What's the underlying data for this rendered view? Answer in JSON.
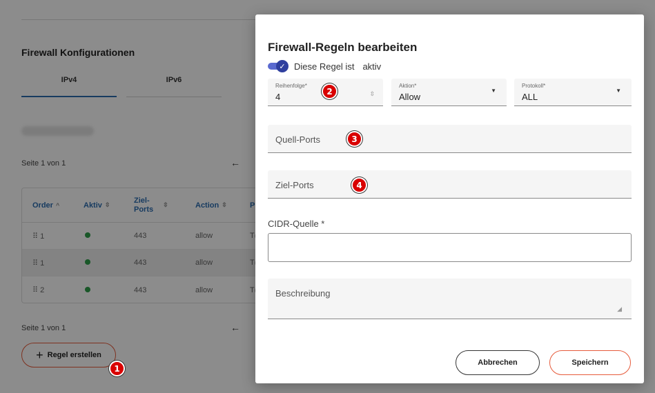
{
  "background": {
    "section_title": "Firewall Konfigurationen",
    "tabs": [
      {
        "label": "IPv4",
        "active": true
      },
      {
        "label": "IPv6",
        "active": false
      }
    ],
    "pagination_top": "Seite 1 von 1",
    "pagination_bottom": "Seite 1 von 1",
    "prev_arrow": "←",
    "table": {
      "headers": [
        {
          "label": "Order",
          "sort": "^"
        },
        {
          "label": "Aktiv",
          "sort": "⇳"
        },
        {
          "label_line1": "Ziel-",
          "label_line2": "Ports",
          "sort": "⇳"
        },
        {
          "label": "Action",
          "sort": "⇳"
        },
        {
          "label": "P"
        }
      ],
      "rows": [
        {
          "order": "⠿ 1",
          "active": true,
          "ports": "443",
          "action": "allow",
          "proto": "T(",
          "highlighted": false
        },
        {
          "order": "⠿ 1",
          "active": true,
          "ports": "443",
          "action": "allow",
          "proto": "T(",
          "highlighted": true
        },
        {
          "order": "⠿ 2",
          "active": true,
          "ports": "443",
          "action": "allow",
          "proto": "T(",
          "highlighted": false
        }
      ]
    },
    "create_button": {
      "icon": "+",
      "label": "Regel erstellen"
    }
  },
  "badges": [
    "1",
    "2",
    "3",
    "4"
  ],
  "modal": {
    "title": "Firewall-Regeln bearbeiten",
    "toggle": {
      "label": "Diese Regel ist",
      "status": "aktiv",
      "on": true,
      "check": "✓"
    },
    "order_field": {
      "label": "Reihenfolge*",
      "value": "4",
      "spinner": "⇳"
    },
    "action_field": {
      "label": "Aktion*",
      "value": "Allow",
      "caret": "▼"
    },
    "protocol_field": {
      "label": "Protokoll*",
      "value": "ALL",
      "caret": "▼"
    },
    "source_ports": {
      "placeholder": "Quell-Ports"
    },
    "dest_ports": {
      "placeholder": "Ziel-Ports"
    },
    "cidr": {
      "label": "CIDR-Quelle *",
      "value": ""
    },
    "description": {
      "placeholder": "Beschreibung",
      "resize": "◢"
    },
    "cancel_label": "Abbrechen",
    "save_label": "Speichern"
  },
  "colors": {
    "accent_blue": "#2b6cb0",
    "toggle": "#2f3f9e",
    "save_border": "#e65a3a",
    "badge": "#d90000",
    "status_green": "#2e9e4a"
  }
}
